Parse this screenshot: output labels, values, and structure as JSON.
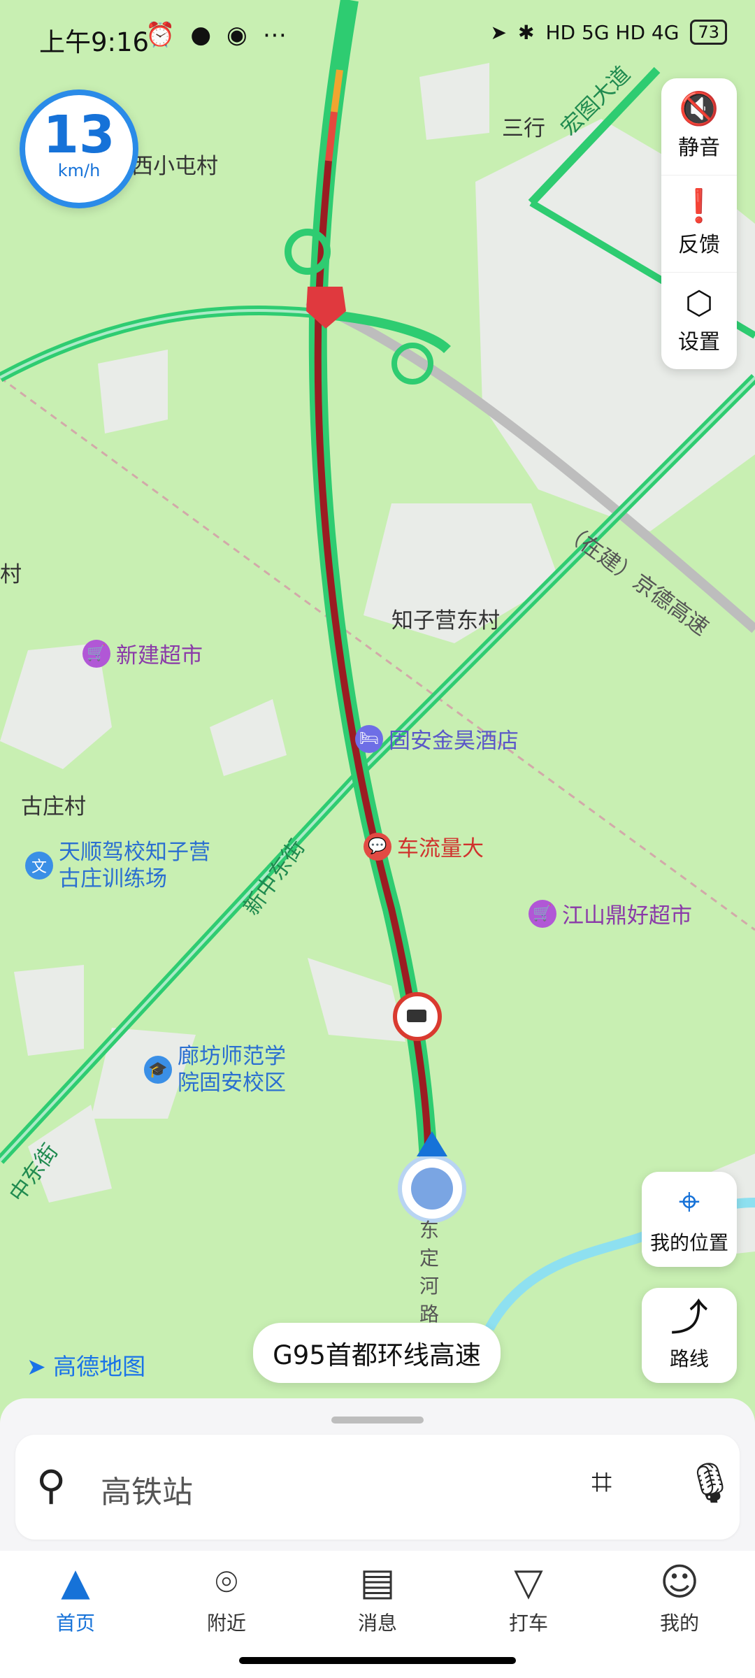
{
  "status_bar": {
    "time": "上午9:16",
    "right_text": "HD 5G HD 4G",
    "battery": "73"
  },
  "speed": {
    "value": "13",
    "unit": "km/h"
  },
  "map_tools": [
    {
      "label": "静音",
      "icon": "speaker-mute-icon"
    },
    {
      "label": "反馈",
      "icon": "feedback-icon"
    },
    {
      "label": "设置",
      "icon": "settings-icon"
    }
  ],
  "map_labels": {
    "village_xixiaotun": "西小屯村",
    "sanxing": "三行",
    "hongtu_ave": "宏图大道",
    "zhiziying_dongcun": "知子营东村",
    "guzhuang_cun": "古庄村",
    "xinzhong_dongjie": "新中东街",
    "xinzhong_dongjie_2": "中东街",
    "jingde_expressway": "（在建）京德高速",
    "road_side": "东定河路",
    "left_cut": "村"
  },
  "pois": {
    "xinjian_market": "新建超市",
    "hotel": "固安金昊酒店",
    "traffic": "车流量大",
    "driving_school": "天顺驾校知子营古庄训练场",
    "jiangshan_market": "江山鼎好超市",
    "college": "廊坊师范学院固安校区"
  },
  "right_buttons": {
    "my_location": "我的位置",
    "route": "路线"
  },
  "logo": "高德地图",
  "current_road": "G95首都环线高速",
  "search": {
    "placeholder": "高铁站"
  },
  "bottom_nav": [
    {
      "label": "首页",
      "icon": "home-icon",
      "active": true
    },
    {
      "label": "附近",
      "icon": "nearby-icon",
      "active": false
    },
    {
      "label": "消息",
      "icon": "message-icon",
      "active": false
    },
    {
      "label": "打车",
      "icon": "taxi-icon",
      "active": false
    },
    {
      "label": "我的",
      "icon": "profile-icon",
      "active": false
    }
  ],
  "colors": {
    "map_bg": "#c8efb2",
    "road_green": "#2ecc71",
    "route_red": "#b3222a",
    "accent_blue": "#1672d8"
  }
}
